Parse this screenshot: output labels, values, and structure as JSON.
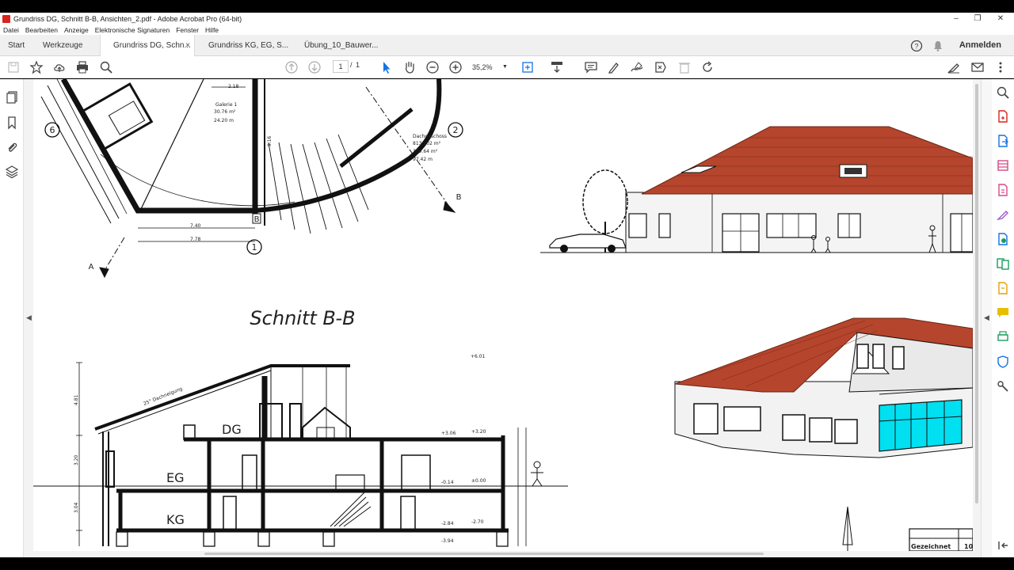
{
  "window": {
    "title": "Grundriss DG, Schnitt B-B, Ansichten_2.pdf - Adobe Acrobat Pro (64-bit)",
    "controls": [
      "–",
      "❐",
      "✕"
    ]
  },
  "menu": [
    "Datei",
    "Bearbeiten",
    "Anzeige",
    "Elektronische Signaturen",
    "Fenster",
    "Hilfe"
  ],
  "tabs": {
    "start": "Start",
    "tools": "Werkzeuge",
    "documents": [
      {
        "label": "Grundriss DG, Schn...",
        "active": true,
        "close": "×"
      },
      {
        "label": "Grundriss KG, EG, S...",
        "active": false
      },
      {
        "label": "Übung_10_Bauwer...",
        "active": false
      }
    ],
    "signin": "Anmelden"
  },
  "toolbar": {
    "page_current": "1",
    "page_sep": "/",
    "page_total": "1",
    "zoom": "35,2%"
  },
  "drawing": {
    "section_title": "Schnitt B-B",
    "floor_labels": [
      "DG",
      "EG",
      "KG"
    ],
    "plan_labels": {
      "room1": "Galerie 1",
      "room1_area": "30.76 m²",
      "room1_perim": "24.20 m",
      "room2": "Dachgeschoss",
      "room2_area": "813.202 m²",
      "room2_perim": "309.64 m²",
      "room2_extra": "97.42 m",
      "dim1": "2.18",
      "dim2": "7.40",
      "dim3": "7.78",
      "dim4": "9.16",
      "axis_markers": [
        "6",
        "2",
        "1"
      ],
      "cut_labels": [
        "B",
        "B",
        "A"
      ]
    },
    "levels": [
      "+6.01",
      "+3.06",
      "+3.20",
      "-0.14",
      "±0.00",
      "-2.84",
      "-2.70",
      "-3.94"
    ],
    "dim_vertical": [
      "4.81",
      "3.20",
      "3.04"
    ],
    "roof_note": "25° Dachneigung",
    "title_block": [
      "Gezeichnet",
      "10"
    ]
  },
  "colors": {
    "roof": "#b5452c",
    "glass": "#00e0f0",
    "accent_red": "#d9251c",
    "acrobat_blue": "#1473e6"
  }
}
